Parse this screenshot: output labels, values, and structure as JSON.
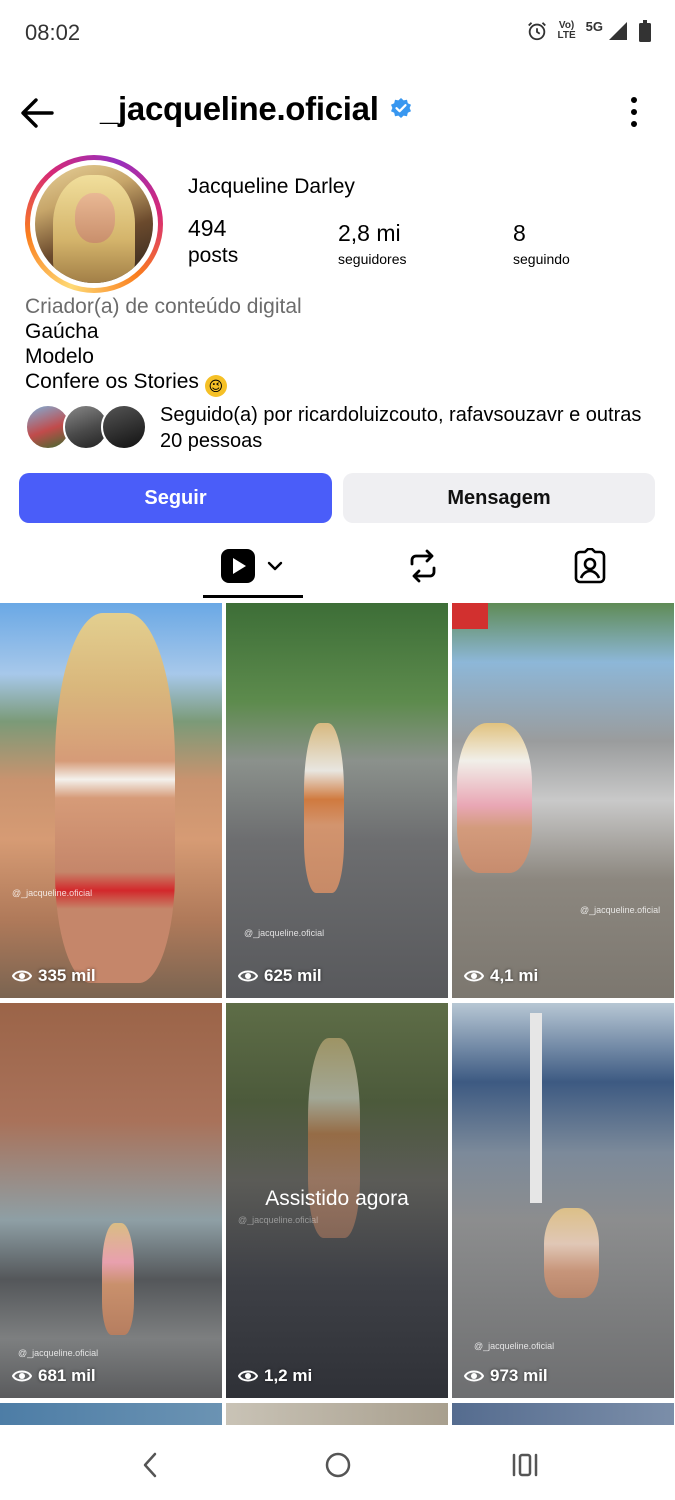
{
  "status_bar": {
    "time": "08:02",
    "volte_top": "Vo)",
    "volte_bottom": "LTE",
    "network": "5G"
  },
  "header": {
    "username": "_jacqueline.oficial"
  },
  "profile": {
    "display_name": "Jacqueline Darley",
    "stats": {
      "posts": {
        "value": "494",
        "label": "posts"
      },
      "followers": {
        "value": "2,8 mi",
        "label": "seguidores"
      },
      "following": {
        "value": "8",
        "label": "seguindo"
      }
    },
    "bio": {
      "category": "Criador(a) de conteúdo digital",
      "lines": [
        "Gaúcha",
        "Modelo",
        "Confere os Stories"
      ],
      "emoji": "😉"
    },
    "followed_by": {
      "prefix": "Seguido(a) por ",
      "users": "ricardoluizcouto, rafavsouzavr",
      "suffix": " e outras 20 pessoas"
    }
  },
  "actions": {
    "follow_label": "Seguir",
    "message_label": "Mensagem"
  },
  "reels": [
    {
      "views": "335 mil",
      "watermark": "@_jacqueline.oficial"
    },
    {
      "views": "625 mil",
      "watermark": "@_jacqueline.oficial"
    },
    {
      "views": "4,1 mi",
      "watermark": "@_jacqueline.oficial"
    },
    {
      "views": "681 mil",
      "watermark": "@_jacqueline.oficial"
    },
    {
      "views": "1,2 mi",
      "watermark": "@_jacqueline.oficial",
      "overlay": "Assistido agora"
    },
    {
      "views": "973 mil",
      "watermark": "@_jacqueline.oficial"
    }
  ],
  "colors": {
    "follow_button": "#4a5df9",
    "message_button": "#efeff2",
    "verified": "#3897f0"
  },
  "icons": [
    "back-arrow-icon",
    "verified-badge-icon",
    "more-options-icon",
    "grid-icon",
    "reels-icon",
    "chevron-down-icon",
    "repost-icon",
    "tagged-icon",
    "eye-icon"
  ]
}
